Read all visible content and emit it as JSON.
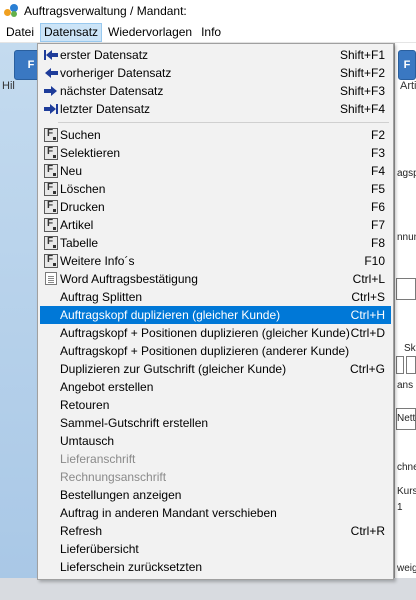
{
  "window": {
    "title": "Auftragsverwaltung / Mandant:"
  },
  "menubar": {
    "items": [
      {
        "label": "Datei"
      },
      {
        "label": "Datensatz"
      },
      {
        "label": "Wiedervorlagen"
      },
      {
        "label": "Info"
      }
    ]
  },
  "background": {
    "toolbar": {
      "btn_left": "F",
      "btn_right": "F",
      "label_left": "Hil",
      "label_right": "Arti"
    },
    "fragments": [
      "agsp",
      "nnun",
      "Sk",
      "ans",
      "Netto",
      "chne",
      "Kurs",
      "1",
      "weig"
    ]
  },
  "dropdown": {
    "items": [
      {
        "label": "erster Datensatz",
        "shortcut": "Shift+F1",
        "icon": "first-record-icon"
      },
      {
        "label": "vorheriger Datensatz",
        "shortcut": "Shift+F2",
        "icon": "previous-record-icon"
      },
      {
        "label": "nächster Datensatz",
        "shortcut": "Shift+F3",
        "icon": "next-record-icon"
      },
      {
        "label": "letzter Datensatz",
        "shortcut": "Shift+F4",
        "icon": "last-record-icon"
      },
      {
        "label": "Suchen",
        "shortcut": "F2",
        "icon": "function-key-icon"
      },
      {
        "label": "Selektieren",
        "shortcut": "F3",
        "icon": "function-key-icon"
      },
      {
        "label": "Neu",
        "shortcut": "F4",
        "icon": "function-key-icon"
      },
      {
        "label": "Löschen",
        "shortcut": "F5",
        "icon": "function-key-icon"
      },
      {
        "label": "Drucken",
        "shortcut": "F6",
        "icon": "function-key-icon"
      },
      {
        "label": "Artikel",
        "shortcut": "F7",
        "icon": "function-key-icon"
      },
      {
        "label": "Tabelle",
        "shortcut": "F8",
        "icon": "function-key-icon"
      },
      {
        "label": "Weitere Info´s",
        "shortcut": "F10",
        "icon": "function-key-icon"
      },
      {
        "label": "Word Auftragsbestätigung",
        "shortcut": "Ctrl+L",
        "icon": "word-document-icon"
      },
      {
        "label": "Auftrag Splitten",
        "shortcut": "Ctrl+S",
        "icon": ""
      },
      {
        "label": "Auftragskopf duplizieren (gleicher Kunde)",
        "shortcut": "Ctrl+H",
        "icon": ""
      },
      {
        "label": "Auftragskopf + Positionen duplizieren (gleicher Kunde)",
        "shortcut": "Ctrl+D",
        "icon": ""
      },
      {
        "label": "Auftragskopf + Positionen duplizieren (anderer Kunde)",
        "shortcut": "",
        "icon": ""
      },
      {
        "label": "Duplizieren zur Gutschrift (gleicher Kunde)",
        "shortcut": "Ctrl+G",
        "icon": ""
      },
      {
        "label": "Angebot erstellen",
        "shortcut": "",
        "icon": ""
      },
      {
        "label": "Retouren",
        "shortcut": "",
        "icon": ""
      },
      {
        "label": "Sammel-Gutschrift erstellen",
        "shortcut": "",
        "icon": ""
      },
      {
        "label": "Umtausch",
        "shortcut": "",
        "icon": ""
      },
      {
        "label": "Lieferanschrift",
        "shortcut": "",
        "icon": "",
        "disabled": true
      },
      {
        "label": "Rechnungsanschrift",
        "shortcut": "",
        "icon": "",
        "disabled": true
      },
      {
        "label": "Bestellungen anzeigen",
        "shortcut": "",
        "icon": ""
      },
      {
        "label": "Auftrag in anderen Mandant verschieben",
        "shortcut": "",
        "icon": ""
      },
      {
        "label": "Refresh",
        "shortcut": "Ctrl+R",
        "icon": ""
      },
      {
        "label": "Lieferübersicht",
        "shortcut": "",
        "icon": ""
      },
      {
        "label": "Lieferschein zurücksetzten",
        "shortcut": "",
        "icon": ""
      }
    ]
  },
  "colors": {
    "selection": "#0078d7",
    "menu_bg": "#f2f2f2",
    "arrow_icon": "#1e3c9a",
    "disabled_text": "#8a8a8a"
  }
}
